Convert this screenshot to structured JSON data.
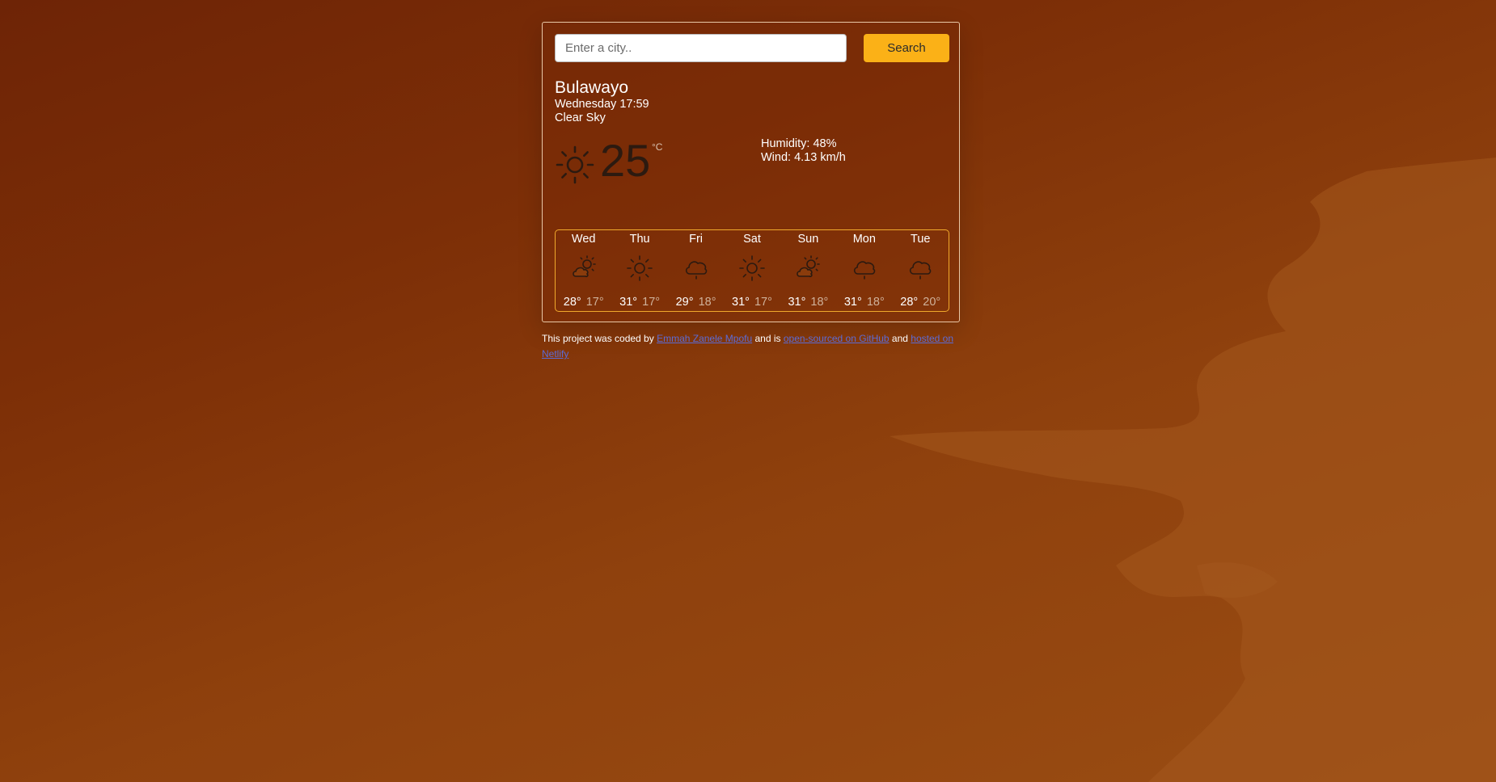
{
  "search": {
    "placeholder": "Enter a city..",
    "button_label": "Search"
  },
  "current": {
    "city": "Bulawayo",
    "datetime": "Wednesday 17:59",
    "description": "Clear Sky",
    "icon": "sun-icon",
    "temperature": "25",
    "unit": "°C",
    "humidity": "Humidity: 48%",
    "wind": "Wind: 4.13 km/h"
  },
  "forecast": [
    {
      "day": "Wed",
      "icon": "partly-cloudy-icon",
      "max": "28°",
      "min": "17°"
    },
    {
      "day": "Thu",
      "icon": "sun-icon",
      "max": "31°",
      "min": "17°"
    },
    {
      "day": "Fri",
      "icon": "cloud-rain-icon",
      "max": "29°",
      "min": "18°"
    },
    {
      "day": "Sat",
      "icon": "sun-icon",
      "max": "31°",
      "min": "17°"
    },
    {
      "day": "Sun",
      "icon": "partly-cloudy-icon",
      "max": "31°",
      "min": "18°"
    },
    {
      "day": "Mon",
      "icon": "cloud-rain-icon",
      "max": "31°",
      "min": "18°"
    },
    {
      "day": "Tue",
      "icon": "cloud-rain-icon",
      "max": "28°",
      "min": "20°"
    }
  ],
  "footer": {
    "text_1": "This project was coded by ",
    "author_link": "Emmah Zanele Mpofu",
    "text_2": " and is ",
    "github_link": "open-sourced on GitHub",
    "text_3": " and ",
    "netlify_link": "hosted on Netlify"
  },
  "colors": {
    "accent": "#fbb117",
    "forecast_border": "#f0a92c",
    "link": "#5b6bd6"
  }
}
